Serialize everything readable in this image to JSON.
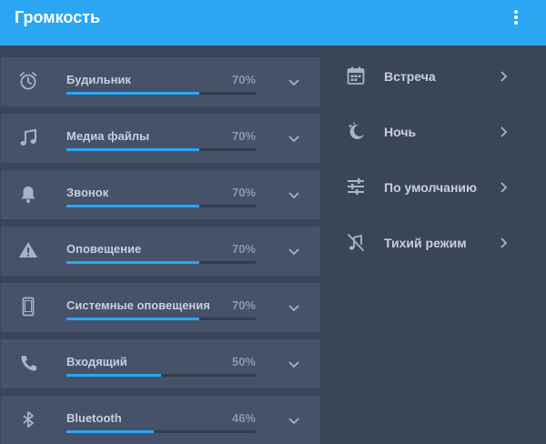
{
  "header": {
    "title": "Громкость",
    "menu_icon": "more-vert-icon"
  },
  "volume_channels": [
    {
      "label": "Будильник",
      "level": 70,
      "level_text": "70%",
      "icon": "alarm-clock-icon"
    },
    {
      "label": "Медиа файлы",
      "level": 70,
      "level_text": "70%",
      "icon": "music-note-icon"
    },
    {
      "label": "Звонок",
      "level": 70,
      "level_text": "70%",
      "icon": "bell-icon"
    },
    {
      "label": "Оповещение",
      "level": 70,
      "level_text": "70%",
      "icon": "warning-icon"
    },
    {
      "label": "Системные оповещения",
      "level": 70,
      "level_text": "70%",
      "icon": "phone-device-icon"
    },
    {
      "label": "Входящий",
      "level": 50,
      "level_text": "50%",
      "icon": "phone-call-icon"
    },
    {
      "label": "Bluetooth",
      "level": 46,
      "level_text": "46%",
      "icon": "bluetooth-icon"
    }
  ],
  "profiles": [
    {
      "label": "Встреча",
      "icon": "calendar-icon"
    },
    {
      "label": "Ночь",
      "icon": "moon-stars-icon"
    },
    {
      "label": "По умолчанию",
      "icon": "equalizer-sliders-icon"
    },
    {
      "label": "Тихий режим",
      "icon": "mute-icon"
    }
  ],
  "colors": {
    "accent": "#2aa6f2",
    "background": "#3a4558",
    "card": "#45526a"
  }
}
